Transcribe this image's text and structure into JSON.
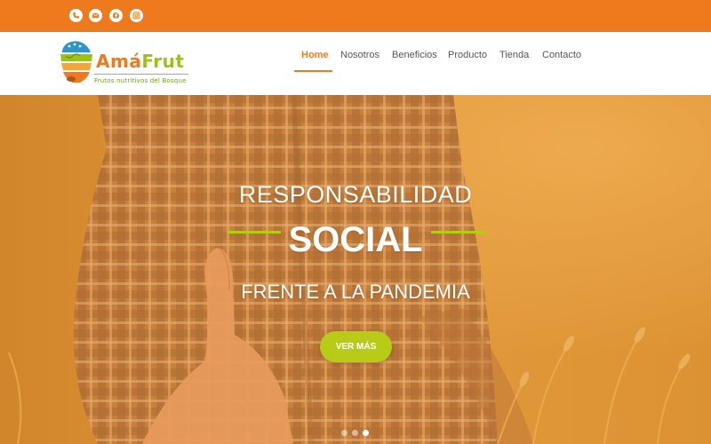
{
  "topbar": {
    "color": "#ef7a1e",
    "social": [
      {
        "name": "phone-icon"
      },
      {
        "name": "email-icon"
      },
      {
        "name": "facebook-icon"
      },
      {
        "name": "instagram-icon"
      }
    ]
  },
  "logo": {
    "word_part1": "Amá",
    "word_part2": "Frut",
    "tagline": "Frutos nutritivos del Bosque"
  },
  "nav": {
    "items": [
      "Home",
      "Nosotros",
      "Beneficios",
      "Producto",
      "Tienda",
      "Contacto"
    ],
    "active": "Home"
  },
  "hero": {
    "line1": "RESPONSABILIDAD",
    "line2": "SOCIAL",
    "line3": "FRENTE A LA PANDEMIA",
    "cta": "VER MÁS",
    "accent_color": "#b8cb16",
    "slides": 3,
    "active_slide": 3
  }
}
